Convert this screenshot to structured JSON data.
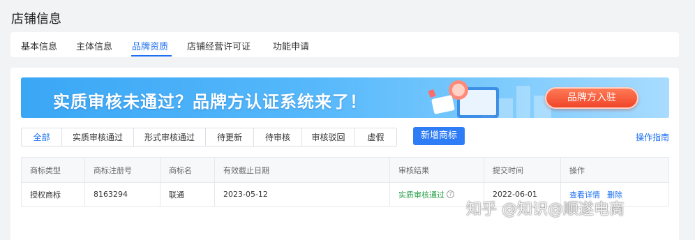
{
  "page_title": "店铺信息",
  "tabs": [
    {
      "label": "基本信息"
    },
    {
      "label": "主体信息"
    },
    {
      "label": "品牌资质"
    },
    {
      "label": "店铺经营许可证"
    },
    {
      "label": "功能申请"
    }
  ],
  "active_tab": "品牌资质",
  "banner": {
    "headline": "实质审核未通过？品牌方认证系统来了！",
    "button_label": "品牌方入驻"
  },
  "filters": [
    {
      "label": "全部"
    },
    {
      "label": "实质审核通过"
    },
    {
      "label": "形式审核通过"
    },
    {
      "label": "待更新"
    },
    {
      "label": "待审核"
    },
    {
      "label": "审核驳回"
    },
    {
      "label": "虚假"
    }
  ],
  "active_filter": "全部",
  "add_button_label": "新增商标",
  "guide_link_label": "操作指南",
  "table": {
    "columns": [
      "商标类型",
      "商标注册号",
      "商标名",
      "有效截止日期",
      "审核结果",
      "提交时间",
      "操作"
    ],
    "rows": [
      {
        "type": "授权商标",
        "reg_no": "8163294",
        "name": "联通",
        "expiry": "2023-05-12",
        "result": "实质审核通过",
        "submitted": "2022-06-01",
        "actions": [
          "查看详情",
          "删除"
        ]
      }
    ]
  },
  "watermark": "知乎 @知识@顺遂电商",
  "colors": {
    "accent": "#1b6ff0",
    "primary_button": "#2f7df6",
    "success": "#2aa04b",
    "banner_button": "#f0452a"
  }
}
